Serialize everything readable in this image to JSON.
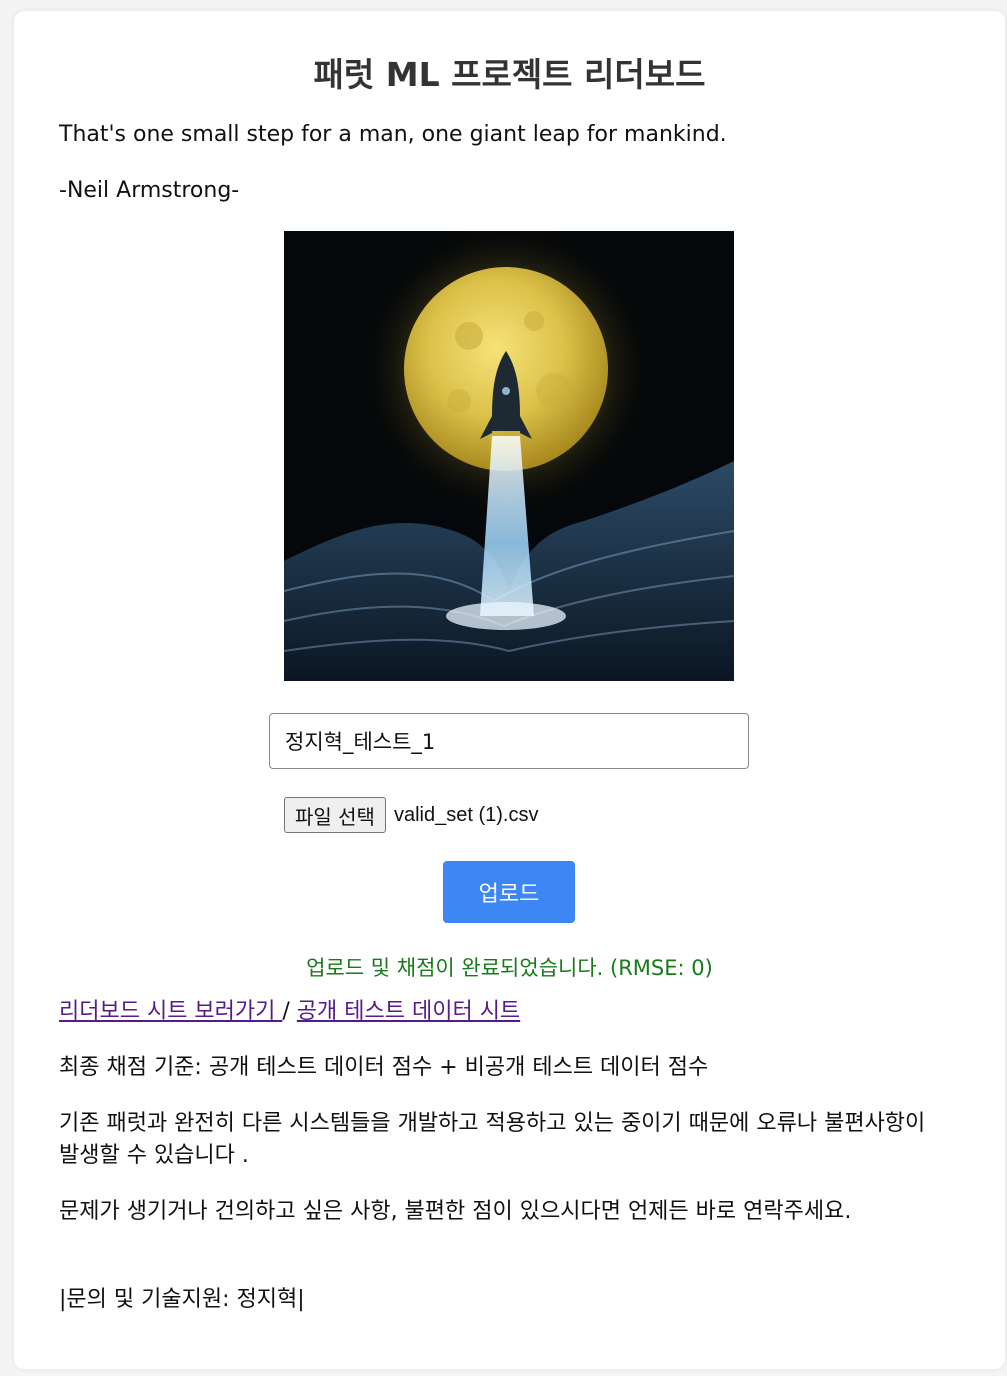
{
  "page": {
    "title": "패럿 ML 프로젝트 리더보드",
    "quote": "That's one small step for a man, one giant leap for mankind.",
    "quote_author": "-Neil Armstrong-"
  },
  "form": {
    "name_value": "정지혁_테스트_1",
    "file_button_label": "파일 선택",
    "file_name": "valid_set (1).csv",
    "upload_label": "업로드"
  },
  "status": {
    "message": "업로드 및 채점이 완료되었습니다. (RMSE: 0)",
    "color": "#1a7a1a"
  },
  "links": {
    "leaderboard": "리더보드 시트 보러가기 ",
    "separator": "/ ",
    "public_test": "공개 테스트 데이터 시트"
  },
  "info": {
    "criteria": "최종 채점 기준: 공개 테스트 데이터 점수 + 비공개 테스트 데이터 점수",
    "notice": "기존 패럿과 완전히 다른 시스템들을 개발하고 적용하고 있는 중이기 때문에 오류나 불편사항이 발생할 수 있습니다 .",
    "contact_request": "문제가 생기거나 건의하고 싶은 사항, 불편한 점이 있으시다면 언제든 바로 연락주세요.",
    "support": "|문의 및 기술지원: 정지혁|"
  },
  "colors": {
    "accent": "#3d87f5",
    "link": "#551a8b"
  }
}
